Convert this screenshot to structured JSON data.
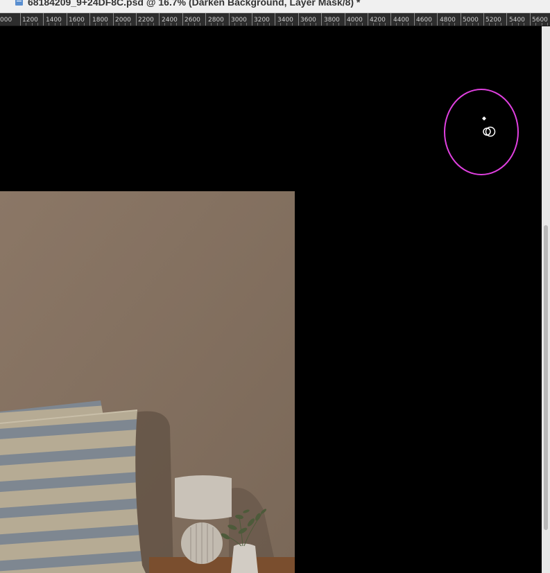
{
  "window": {
    "title": "68184209_9+24DF8C.psd @ 16.7% (Darken Background, Layer Mask/8) *"
  },
  "ruler": {
    "labels": [
      "000",
      "1200",
      "1400",
      "1600",
      "1800",
      "2000",
      "2200",
      "2400",
      "2600",
      "2800",
      "3000",
      "3200",
      "3400",
      "3600",
      "3800",
      "4000",
      "4200",
      "4400",
      "4600",
      "4800",
      "5000",
      "5200",
      "5400",
      "5600"
    ]
  },
  "icons": {
    "document": "document-icon",
    "brush": "brush-cursor-icon"
  },
  "colors": {
    "brush_outline": "#e040e0",
    "canvas_bg": "#000000"
  }
}
